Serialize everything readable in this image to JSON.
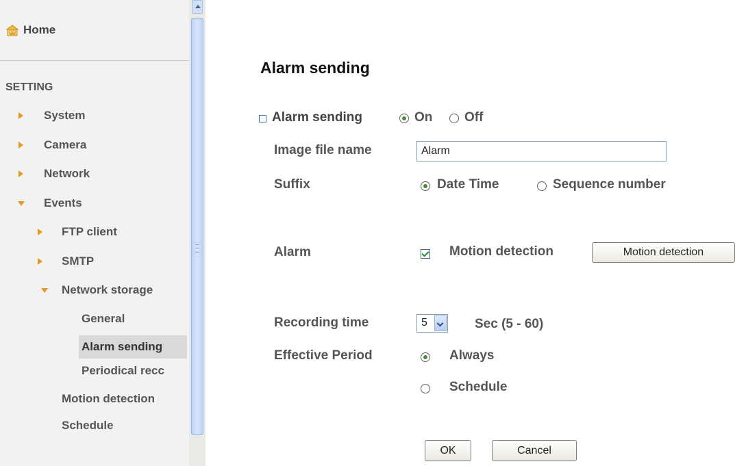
{
  "sidebar": {
    "home_label": "Home",
    "section_label": "SETTING",
    "items": [
      {
        "label": "System"
      },
      {
        "label": "Camera"
      },
      {
        "label": "Network"
      },
      {
        "label": "Events"
      },
      {
        "label": "FTP client"
      },
      {
        "label": "SMTP"
      },
      {
        "label": "Network storage"
      },
      {
        "label": "General"
      },
      {
        "label": "Alarm sending"
      },
      {
        "label": "Periodical recc"
      },
      {
        "label": "Motion detection"
      },
      {
        "label": "Schedule"
      }
    ],
    "selected": "Alarm sending"
  },
  "form": {
    "title": "Alarm sending",
    "alarm_sending": {
      "label": "Alarm sending",
      "on_label": "On",
      "off_label": "Off",
      "value": "On"
    },
    "image_file_name": {
      "label": "Image file name",
      "value": "Alarm"
    },
    "suffix": {
      "label": "Suffix",
      "opt_date": "Date Time",
      "opt_seq": "Sequence number",
      "value": "Date Time"
    },
    "alarm": {
      "label": "Alarm",
      "checkbox_label": "Motion detection",
      "checked": true,
      "button_label": "Motion detection"
    },
    "recording_time": {
      "label": "Recording time",
      "value": "5",
      "range_label": "Sec (5 - 60)"
    },
    "effective_period": {
      "label": "Effective Period",
      "opt_always": "Always",
      "opt_schedule": "Schedule",
      "value": "Always"
    },
    "ok_label": "OK",
    "cancel_label": "Cancel"
  }
}
